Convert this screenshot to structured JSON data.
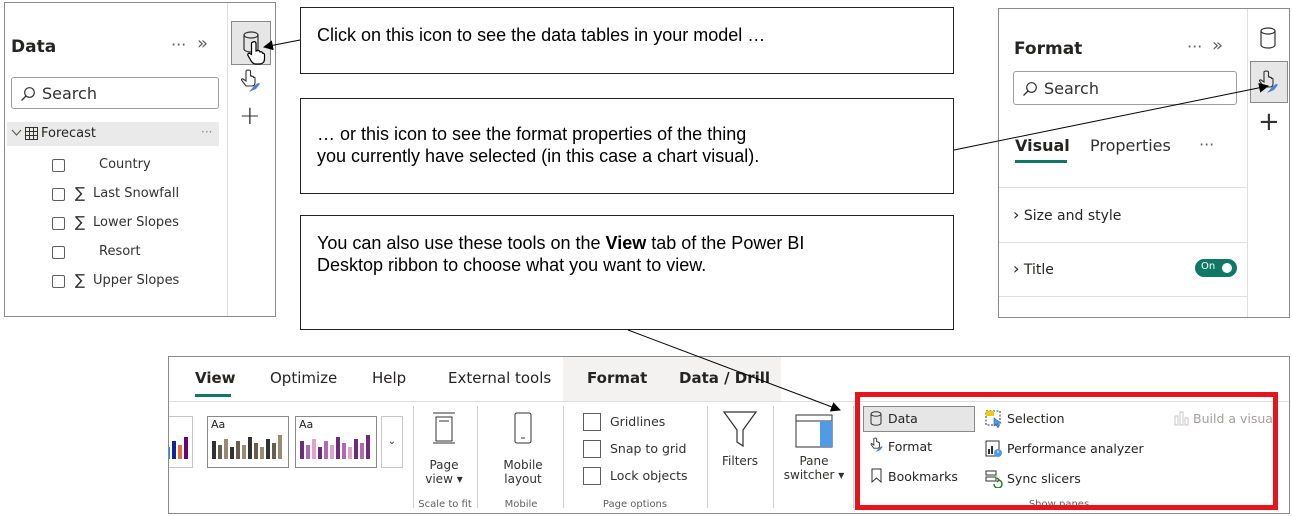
{
  "data_pane": {
    "title": "Data",
    "more": "···",
    "collapse": "»",
    "search_placeholder": "Search",
    "table": {
      "name": "Forecast",
      "more": "···"
    },
    "fields": [
      {
        "label": "Country",
        "sigma": ""
      },
      {
        "label": "Last Snowfall",
        "sigma": "∑"
      },
      {
        "label": "Lower Slopes",
        "sigma": "∑"
      },
      {
        "label": "Resort",
        "sigma": ""
      },
      {
        "label": "Upper Slopes",
        "sigma": "∑"
      }
    ]
  },
  "format_pane": {
    "title": "Format",
    "more": "···",
    "collapse": "»",
    "search_placeholder": "Search",
    "tabs": [
      "Visual",
      "Properties"
    ],
    "tabs_more": "···",
    "sections": [
      {
        "label": "Size and style"
      },
      {
        "label": "Title",
        "toggle": "On"
      }
    ]
  },
  "callouts": {
    "data_icon": "Click on this icon to see the data tables in your model …",
    "format_icon_line1": "… or this icon to see the format properties of the thing",
    "format_icon_line2": "you currently have selected (in this case a chart visual).",
    "view_tab_pre": "You can also use these tools on the ",
    "view_tab_bold": "View",
    "view_tab_post": " tab of the Power BI Desktop ribbon to choose what you want to view."
  },
  "ribbon": {
    "tabs": [
      "View",
      "Optimize",
      "Help",
      "External tools",
      "Format",
      "Data / Drill"
    ],
    "active_tab": "View",
    "theme_aa_1": "Aa",
    "theme_aa_2": "Aa",
    "page_view": {
      "line1": "Page",
      "line2": "view ▾"
    },
    "scale_to_fit": "Scale to fit",
    "mobile_layout": {
      "line1": "Mobile",
      "line2": "layout"
    },
    "mobile_group": "Mobile",
    "page_options": {
      "items": [
        "Gridlines",
        "Snap to grid",
        "Lock objects"
      ],
      "group": "Page options"
    },
    "filters": "Filters",
    "pane_switcher": {
      "line1": "Pane",
      "line2": "switcher ▾"
    },
    "show_panes": {
      "col1": [
        "Data",
        "Format",
        "Bookmarks"
      ],
      "col2": [
        "Selection",
        "Performance analyzer",
        "Sync slicers"
      ],
      "build": "Build a visual",
      "group": "Show panes"
    },
    "highlight_color": "#e8141b",
    "accent_color": "#117865"
  }
}
